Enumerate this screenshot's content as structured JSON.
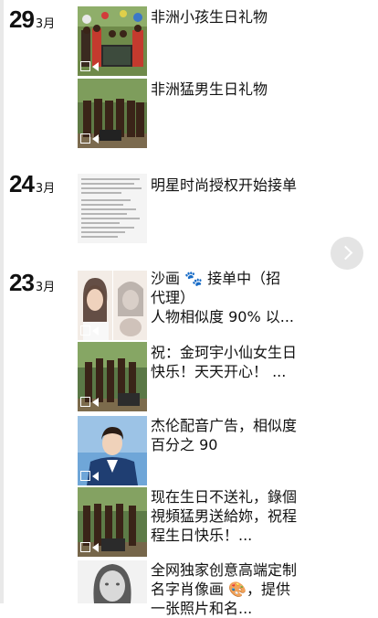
{
  "groups": [
    {
      "day": "29",
      "month": "3月",
      "posts": [
        {
          "text": "非洲小孩生日礼物",
          "type": "video"
        },
        {
          "text": "非洲猛男生日礼物",
          "type": "video"
        }
      ]
    },
    {
      "day": "24",
      "month": "3月",
      "posts": [
        {
          "text": "明星时尚授权开始接单",
          "type": "image"
        }
      ]
    },
    {
      "day": "23",
      "month": "3月",
      "posts": [
        {
          "line1": "沙画 🐾 接单中（招代理）",
          "line2": "人物相似度 90% 以...",
          "type": "video"
        },
        {
          "text": "祝：金珂宇小仙女生日快乐！天天开心！ ...",
          "type": "video"
        },
        {
          "text": "杰伦配音广告，相似度百分之 90",
          "type": "video"
        },
        {
          "text": "现在生日不送礼，錄個視頻猛男送給妳，祝程程生日快乐！...",
          "type": "video"
        },
        {
          "text": "全网独家创意高端定制名字肖像画 🎨，提供一张照片和名...",
          "type": "image"
        }
      ]
    }
  ],
  "icons": {
    "video": "video-camera-icon",
    "speaker": "speaker-icon",
    "next": "chevron-right-icon"
  },
  "colors": {
    "background": "#ffffff",
    "text": "#111111",
    "scroll_button": "#e2e2e2"
  }
}
